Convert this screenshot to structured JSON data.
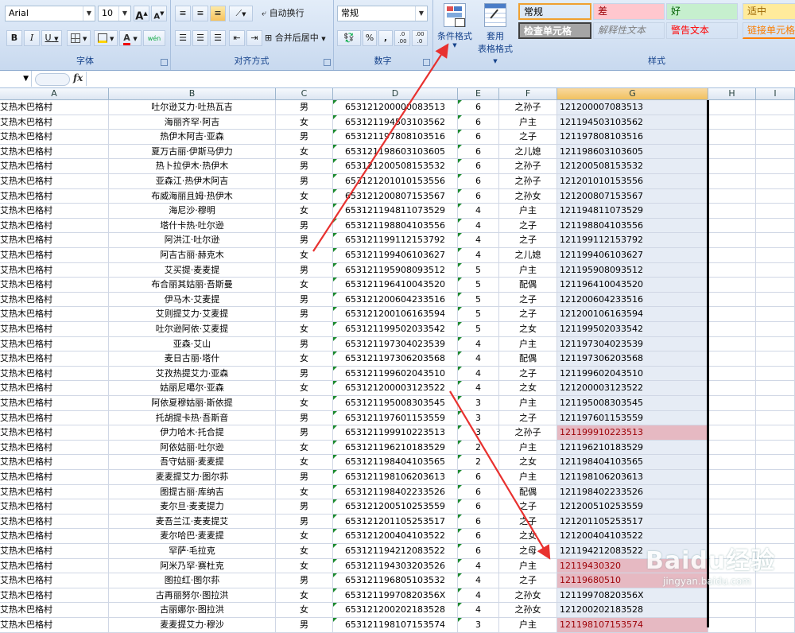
{
  "ribbon": {
    "font": {
      "name": "Arial",
      "size": "10",
      "grow": "A",
      "shrink": "A",
      "bold": "B",
      "italic": "I",
      "underline": "U",
      "title": "字体",
      "phonetic": "wén"
    },
    "align": {
      "wrap": "自动换行",
      "merge": "合并后居中",
      "title": "对齐方式"
    },
    "number": {
      "format": "常规",
      "percent": "%",
      "comma": ",",
      "inc_decimal": ".0 .00",
      "dec_decimal": ".00 .0",
      "title": "数字"
    },
    "styles": {
      "conditional_format": "条件格式",
      "table_format_1": "套用",
      "table_format_2": "表格格式",
      "title": "样式",
      "cells": [
        {
          "label": "常规",
          "bg": "#ffffff",
          "color": "#000000"
        },
        {
          "label": "差",
          "bg": "#ffc7ce",
          "color": "#9c0006"
        },
        {
          "label": "好",
          "bg": "#c6efce",
          "color": "#006100"
        },
        {
          "label": "适中",
          "bg": "#ffeb9c",
          "color": "#9c6500"
        },
        {
          "label": "检查单元格",
          "bg": "#a5a5a5",
          "color": "#ffffff"
        },
        {
          "label": "解释性文本",
          "bg": "#ffffff",
          "color": "#7f7f7f"
        },
        {
          "label": "警告文本",
          "bg": "#ffffff",
          "color": "#ff0000"
        },
        {
          "label": "链接单元格",
          "bg": "#ffffff",
          "color": "#fa7d00"
        }
      ]
    }
  },
  "formula_bar": {
    "fx": "fx",
    "value": ""
  },
  "columns": [
    "A",
    "B",
    "C",
    "D",
    "E",
    "F",
    "G",
    "H",
    "I"
  ],
  "rows": [
    {
      "a": "艾热木巴格村",
      "b": "吐尔逊艾力·吐热瓦吉",
      "c": "男",
      "d": "653121200000083513",
      "e": "6",
      "f": "之孙子",
      "g": "121200007083513",
      "hl": false
    },
    {
      "a": "艾热木巴格村",
      "b": "海丽齐罕·阿吉",
      "c": "女",
      "d": "653121194503103562",
      "e": "6",
      "f": "户主",
      "g": "121194503103562",
      "hl": false
    },
    {
      "a": "艾热木巴格村",
      "b": "热伊木阿吉·亚森",
      "c": "男",
      "d": "653121197808103516",
      "e": "6",
      "f": "之子",
      "g": "121197808103516",
      "hl": false
    },
    {
      "a": "艾热木巴格村",
      "b": "夏万古丽·伊斯马伊力",
      "c": "女",
      "d": "653121198603103605",
      "e": "6",
      "f": "之儿媳",
      "g": "121198603103605",
      "hl": false
    },
    {
      "a": "艾热木巴格村",
      "b": "热卜拉伊木·热伊木",
      "c": "男",
      "d": "653121200508153532",
      "e": "6",
      "f": "之孙子",
      "g": "121200508153532",
      "hl": false
    },
    {
      "a": "艾热木巴格村",
      "b": "亚森江·热伊木阿吉",
      "c": "男",
      "d": "653121201010153556",
      "e": "6",
      "f": "之孙子",
      "g": "121201010153556",
      "hl": false
    },
    {
      "a": "艾热木巴格村",
      "b": "布威海丽且姆·热伊木",
      "c": "女",
      "d": "653121200807153567",
      "e": "6",
      "f": "之孙女",
      "g": "121200807153567",
      "hl": false
    },
    {
      "a": "艾热木巴格村",
      "b": "海尼沙·穆明",
      "c": "女",
      "d": "653121194811073529",
      "e": "4",
      "f": "户主",
      "g": "121194811073529",
      "hl": false
    },
    {
      "a": "艾热木巴格村",
      "b": "塔什卡热·吐尔逊",
      "c": "男",
      "d": "653121198804103556",
      "e": "4",
      "f": "之子",
      "g": "121198804103556",
      "hl": false
    },
    {
      "a": "艾热木巴格村",
      "b": "阿洪江·吐尔逊",
      "c": "男",
      "d": "653121199112153792",
      "e": "4",
      "f": "之子",
      "g": "121199112153792",
      "hl": false
    },
    {
      "a": "艾热木巴格村",
      "b": "阿吉古丽·赫克木",
      "c": "女",
      "d": "653121199406103627",
      "e": "4",
      "f": "之儿媳",
      "g": "121199406103627",
      "hl": false
    },
    {
      "a": "艾热木巴格村",
      "b": "艾买提·麦麦提",
      "c": "男",
      "d": "653121195908093512",
      "e": "5",
      "f": "户主",
      "g": "121195908093512",
      "hl": false
    },
    {
      "a": "艾热木巴格村",
      "b": "布合丽其姑丽·吾斯曼",
      "c": "女",
      "d": "653121196410043520",
      "e": "5",
      "f": "配偶",
      "g": "121196410043520",
      "hl": false
    },
    {
      "a": "艾热木巴格村",
      "b": "伊马木·艾麦提",
      "c": "男",
      "d": "653121200604233516",
      "e": "5",
      "f": "之子",
      "g": "121200604233516",
      "hl": false
    },
    {
      "a": "艾热木巴格村",
      "b": "艾则提艾力·艾麦提",
      "c": "男",
      "d": "653121200106163594",
      "e": "5",
      "f": "之子",
      "g": "121200106163594",
      "hl": false
    },
    {
      "a": "艾热木巴格村",
      "b": "吐尔逊阿依·艾麦提",
      "c": "女",
      "d": "653121199502033542",
      "e": "5",
      "f": "之女",
      "g": "121199502033542",
      "hl": false
    },
    {
      "a": "艾热木巴格村",
      "b": "亚森·艾山",
      "c": "男",
      "d": "653121197304023539",
      "e": "4",
      "f": "户主",
      "g": "121197304023539",
      "hl": false
    },
    {
      "a": "艾热木巴格村",
      "b": "麦日古丽·塔什",
      "c": "女",
      "d": "653121197306203568",
      "e": "4",
      "f": "配偶",
      "g": "121197306203568",
      "hl": false
    },
    {
      "a": "艾热木巴格村",
      "b": "艾孜热提艾力·亚森",
      "c": "男",
      "d": "653121199602043510",
      "e": "4",
      "f": "之子",
      "g": "121199602043510",
      "hl": false
    },
    {
      "a": "艾热木巴格村",
      "b": "姑丽尼噶尔·亚森",
      "c": "女",
      "d": "653121200003123522",
      "e": "4",
      "f": "之女",
      "g": "121200003123522",
      "hl": false
    },
    {
      "a": "艾热木巴格村",
      "b": "阿依夏穆姑丽·斯依提",
      "c": "女",
      "d": "653121195008303545",
      "e": "3",
      "f": "户主",
      "g": "121195008303545",
      "hl": false
    },
    {
      "a": "艾热木巴格村",
      "b": "托胡提卡热·吾斯音",
      "c": "男",
      "d": "653121197601153559",
      "e": "3",
      "f": "之子",
      "g": "121197601153559",
      "hl": false
    },
    {
      "a": "艾热木巴格村",
      "b": "伊力哈木·托合提",
      "c": "男",
      "d": "653121199910223513",
      "e": "3",
      "f": "之孙子",
      "g": "121199910223513",
      "hl": true
    },
    {
      "a": "艾热木巴格村",
      "b": "阿依姑丽·吐尔逊",
      "c": "女",
      "d": "653121196210183529",
      "e": "2",
      "f": "户主",
      "g": "121196210183529",
      "hl": false
    },
    {
      "a": "艾热木巴格村",
      "b": "吾守姑丽·麦麦提",
      "c": "女",
      "d": "653121198404103565",
      "e": "2",
      "f": "之女",
      "g": "121198404103565",
      "hl": false
    },
    {
      "a": "艾热木巴格村",
      "b": "麦麦提艾力·图尔荪",
      "c": "男",
      "d": "653121198106203613",
      "e": "6",
      "f": "户主",
      "g": "121198106203613",
      "hl": false
    },
    {
      "a": "艾热木巴格村",
      "b": "图提古丽·库纳吉",
      "c": "女",
      "d": "653121198402233526",
      "e": "6",
      "f": "配偶",
      "g": "121198402233526",
      "hl": false
    },
    {
      "a": "艾热木巴格村",
      "b": "麦尔旦·麦麦提力",
      "c": "男",
      "d": "653121200510253559",
      "e": "6",
      "f": "之子",
      "g": "121200510253559",
      "hl": false
    },
    {
      "a": "艾热木巴格村",
      "b": "麦吾兰江·麦麦提艾",
      "c": "男",
      "d": "653121201105253517",
      "e": "6",
      "f": "之子",
      "g": "121201105253517",
      "hl": false
    },
    {
      "a": "艾热木巴格村",
      "b": "麦尔哈巴·麦麦提",
      "c": "女",
      "d": "653121200404103522",
      "e": "6",
      "f": "之女",
      "g": "121200404103522",
      "hl": false
    },
    {
      "a": "艾热木巴格村",
      "b": "罕萨·毛拉克",
      "c": "女",
      "d": "653121194212083522",
      "e": "6",
      "f": "之母",
      "g": "121194212083522",
      "hl": false
    },
    {
      "a": "艾热木巴格村",
      "b": "阿米乃罕·赛杜克",
      "c": "女",
      "d": "653121194303203526",
      "e": "4",
      "f": "户主",
      "g": "12119430320",
      "hl": true
    },
    {
      "a": "艾热木巴格村",
      "b": "图拉红·图尔荪",
      "c": "男",
      "d": "653121196805103532",
      "e": "4",
      "f": "之子",
      "g": "12119680510",
      "hl": true
    },
    {
      "a": "艾热木巴格村",
      "b": "古再丽努尔·图拉洪",
      "c": "女",
      "d": "65312119970820356X",
      "e": "4",
      "f": "之孙女",
      "g": "12119970820356X",
      "hl": false
    },
    {
      "a": "艾热木巴格村",
      "b": "古丽娜尔·图拉洪",
      "c": "女",
      "d": "653121200202183528",
      "e": "4",
      "f": "之孙女",
      "g": "121200202183528",
      "hl": false
    },
    {
      "a": "艾热木巴格村",
      "b": "麦麦提艾力·穆沙",
      "c": "男",
      "d": "653121198107153574",
      "e": "3",
      "f": "户主",
      "g": "121198107153574",
      "hl": true
    }
  ],
  "watermark": {
    "main": "Baidu经验",
    "sub": "jingyan.baidu.com"
  },
  "colors": {
    "accent": "#15428b",
    "highlight_fill": "#e6b9c2",
    "highlight_text": "#9c0006",
    "annotation_arrow": "#e8312f"
  }
}
